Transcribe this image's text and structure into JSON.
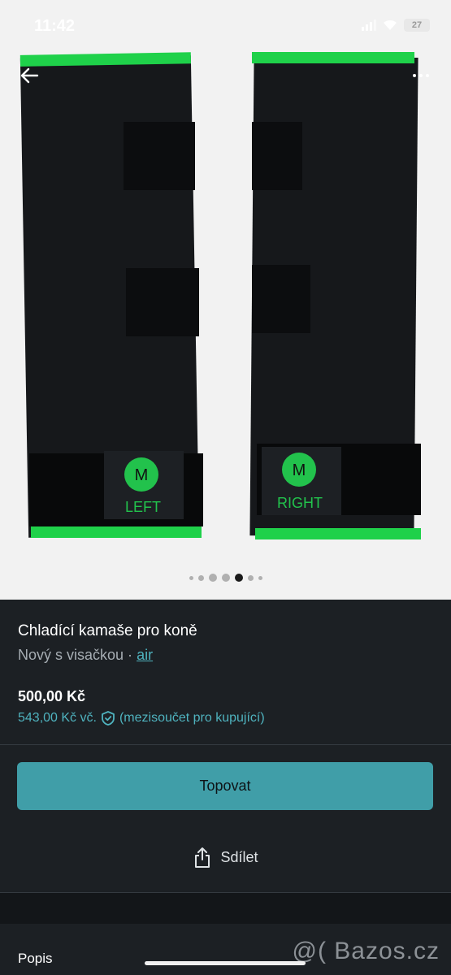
{
  "status_bar": {
    "time": "11:42",
    "battery": "27"
  },
  "gallery": {
    "left_label": "LEFT",
    "right_label": "RIGHT",
    "size_badge": "M",
    "page_count": 7,
    "active_index": 4
  },
  "listing": {
    "title": "Chladící kamaše pro koně",
    "condition": "Nový s visačkou ·",
    "brand": "air",
    "price": "500,00 Kč",
    "price_total": "543,00 Kč vč.",
    "buyer_note": "(mezisoučet pro kupující)"
  },
  "actions": {
    "bump_label": "Topovat",
    "share_label": "Sdílet"
  },
  "description": {
    "heading": "Popis"
  },
  "watermark": "@( Bazos.cz",
  "colors": {
    "accent": "#409ea8",
    "link": "#4fb3bf",
    "background": "#1c2024"
  }
}
